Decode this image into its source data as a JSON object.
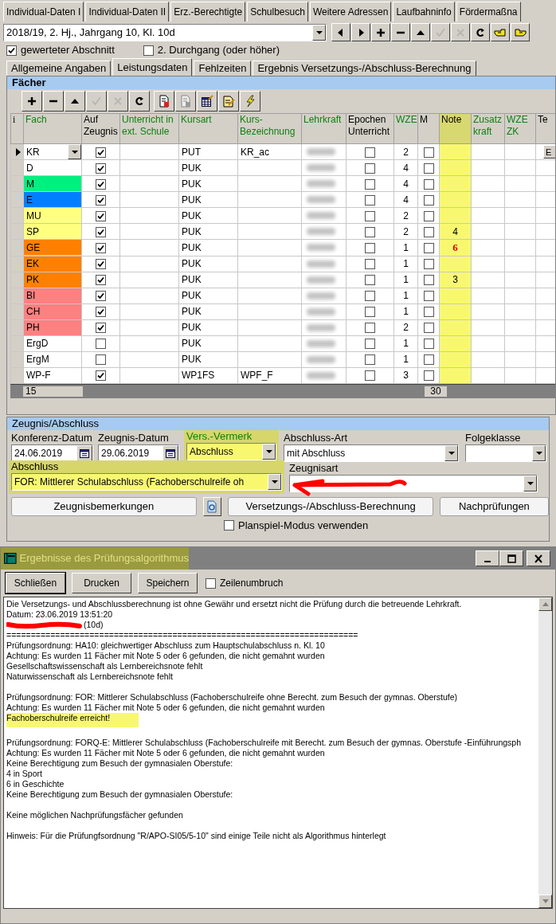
{
  "top_tabs": [
    {
      "label": "Individual-Daten I"
    },
    {
      "label": "Individual-Daten II"
    },
    {
      "label": "Erz.-Berechtigte"
    },
    {
      "label": "Schulbesuch"
    },
    {
      "label": "Weitere Adressen"
    },
    {
      "label": "Laufbahninfo"
    },
    {
      "label": "Fördermaßna"
    }
  ],
  "section_select": {
    "value": "2018/19, 2. Hj., Jahrgang 10, Kl. 10d"
  },
  "nav_buttons": [
    {
      "kind": "prev",
      "disabled": false
    },
    {
      "kind": "next",
      "disabled": false
    },
    {
      "kind": "plus",
      "disabled": false
    },
    {
      "kind": "minus",
      "disabled": false
    },
    {
      "kind": "up",
      "disabled": false
    },
    {
      "kind": "check",
      "disabled": true
    },
    {
      "kind": "cancel",
      "disabled": true
    },
    {
      "kind": "refresh",
      "disabled": false
    },
    {
      "kind": "hand",
      "disabled": false
    },
    {
      "kind": "hand2",
      "disabled": false
    }
  ],
  "options": [
    {
      "label": "gewerteter Abschnitt",
      "checked": true
    },
    {
      "label": "2. Durchgang (oder höher)",
      "checked": false
    }
  ],
  "tabs": [
    {
      "label": "Allgemeine Angaben",
      "selected": false
    },
    {
      "label": "Leistungsdaten",
      "selected": true
    },
    {
      "label": "Fehlzeiten",
      "selected": false
    },
    {
      "label": "Ergebnis Versetzungs-/Abschluss-Berechnung",
      "selected": false
    }
  ],
  "faecher": {
    "title": "Fächer",
    "toolbar": [
      {
        "kind": "plus",
        "disabled": false
      },
      {
        "kind": "minus",
        "disabled": false
      },
      {
        "kind": "up",
        "disabled": false
      },
      {
        "kind": "check",
        "disabled": true
      },
      {
        "kind": "cancel",
        "disabled": true
      },
      {
        "kind": "refresh",
        "disabled": false
      },
      {
        "kind": "doc-red",
        "disabled": false
      },
      {
        "kind": "doc-gray",
        "disabled": false
      },
      {
        "kind": "table-edit",
        "disabled": false
      },
      {
        "kind": "doc-pencil",
        "disabled": false
      },
      {
        "kind": "bolt",
        "disabled": false
      }
    ],
    "columns": [
      {
        "label": "i",
        "accent": false
      },
      {
        "label": "Fach",
        "accent": true
      },
      {
        "label": "Auf\nZeugnis",
        "accent": false
      },
      {
        "label": "Unterricht in\next. Schule",
        "accent": true
      },
      {
        "label": "Kursart",
        "accent": true
      },
      {
        "label": "Kurs-\nBezeichnung",
        "accent": true
      },
      {
        "label": "Lehrkraft",
        "accent": true
      },
      {
        "label": "Epochen\nUnterricht",
        "accent": false
      },
      {
        "label": "WZE",
        "accent": true
      },
      {
        "label": "M",
        "accent": false
      },
      {
        "label": "Note",
        "accent": false
      },
      {
        "label": "Zusatz\nkraft",
        "accent": true
      },
      {
        "label": "WZE\nZK",
        "accent": true
      },
      {
        "label": "Te",
        "accent": false
      }
    ],
    "rows": [
      {
        "fach": "KR",
        "color": "#ffffff",
        "selected": true,
        "auf_zeugnis": true,
        "kursart": "PUT",
        "kurs_bezeichnung": "KR_ac",
        "epochen": false,
        "wze": "2",
        "m": false,
        "extra": "E"
      },
      {
        "fach": "D",
        "color": "#ffffff",
        "selected": false,
        "auf_zeugnis": true,
        "kursart": "PUK",
        "epochen": false,
        "wze": "4",
        "m": false
      },
      {
        "fach": "M",
        "color": "#00f080",
        "selected": false,
        "auf_zeugnis": true,
        "kursart": "PUK",
        "epochen": false,
        "wze": "4",
        "m": false
      },
      {
        "fach": "E",
        "color": "#0080ff",
        "selected": false,
        "auf_zeugnis": true,
        "kursart": "PUK",
        "epochen": false,
        "wze": "4",
        "m": false
      },
      {
        "fach": "MU",
        "color": "#ffff80",
        "selected": false,
        "auf_zeugnis": true,
        "kursart": "PUK",
        "epochen": false,
        "wze": "2",
        "m": false
      },
      {
        "fach": "SP",
        "color": "#ffff80",
        "selected": false,
        "auf_zeugnis": true,
        "kursart": "PUK",
        "epochen": false,
        "wze": "2",
        "m": false,
        "note": "4",
        "note_alert": false
      },
      {
        "fach": "GE",
        "color": "#ff8000",
        "selected": false,
        "auf_zeugnis": true,
        "kursart": "PUK",
        "epochen": false,
        "wze": "1",
        "m": false,
        "note": "6",
        "note_alert": true
      },
      {
        "fach": "EK",
        "color": "#ff8000",
        "selected": false,
        "auf_zeugnis": true,
        "kursart": "PUK",
        "epochen": false,
        "wze": "1",
        "m": false
      },
      {
        "fach": "PK",
        "color": "#ff8000",
        "selected": false,
        "auf_zeugnis": true,
        "kursart": "PUK",
        "epochen": false,
        "wze": "1",
        "m": false,
        "note": "3",
        "note_alert": false
      },
      {
        "fach": "BI",
        "color": "#ff8080",
        "selected": false,
        "auf_zeugnis": true,
        "kursart": "PUK",
        "epochen": false,
        "wze": "1",
        "m": false
      },
      {
        "fach": "CH",
        "color": "#ff8080",
        "selected": false,
        "auf_zeugnis": true,
        "kursart": "PUK",
        "epochen": false,
        "wze": "1",
        "m": false
      },
      {
        "fach": "PH",
        "color": "#ff8080",
        "selected": false,
        "auf_zeugnis": true,
        "kursart": "PUK",
        "epochen": false,
        "wze": "2",
        "m": false
      },
      {
        "fach": "ErgD",
        "color": "#ffffff",
        "selected": false,
        "auf_zeugnis": false,
        "kursart": "PUK",
        "epochen": false,
        "wze": "1",
        "m": false
      },
      {
        "fach": "ErgM",
        "color": "#ffffff",
        "selected": false,
        "auf_zeugnis": false,
        "kursart": "PUK",
        "epochen": false,
        "wze": "1",
        "m": false
      },
      {
        "fach": "WP-F",
        "color": "#ffffff",
        "selected": false,
        "auf_zeugnis": true,
        "kursart": "WP1FS",
        "kurs_bezeichnung": "WPF_F",
        "epochen": false,
        "wze": "3",
        "m": false
      }
    ],
    "footer": {
      "fach_count": "15",
      "wze_sum": "30"
    }
  },
  "zeugnis": {
    "title": "Zeugnis/Abschluss",
    "konferenz_datum": {
      "label": "Konferenz-Datum",
      "value": "24.06.2019"
    },
    "zeugnis_datum": {
      "label": "Zeugnis-Datum",
      "value": "29.06.2019"
    },
    "vers_vermerk": {
      "label": "Vers.-Vermerk",
      "value": "Abschluss"
    },
    "abschluss_art": {
      "label": "Abschluss-Art",
      "value": "mit Abschluss"
    },
    "folgeklasse": {
      "label": "Folgeklasse"
    },
    "abschluss": {
      "label": "Abschluss",
      "value": "FOR: Mittlerer Schulabschluss (Fachoberschulreife oh"
    },
    "zeugnisart": {
      "label": "Zeugnisart"
    },
    "buttons": [
      "Zeugnisbemerkungen",
      "Versetzungs-/Abschluss-Berechnung",
      "Nachprüfungen"
    ],
    "planspiel": {
      "label": "Planspiel-Modus verwenden",
      "checked": false
    }
  },
  "dialog": {
    "title": "Ergebnisse des Prüfungsalgorithmus",
    "buttons": [
      "Schließen",
      "Drucken",
      "Speichern"
    ],
    "wrap": {
      "label": "Zeilenumbruch",
      "checked": false
    },
    "lines": [
      {
        "kind": "line",
        "text": "Die Versetzungs- und Abschlussberechnung ist ohne Gewähr und ersetzt nicht die Prüfung durch die betreuende Lehrkraft."
      },
      {
        "kind": "line",
        "text": "Datum: 23.06.2019 13:51:20"
      },
      {
        "kind": "redacted",
        "text": "(10d)"
      },
      {
        "kind": "line",
        "text": "========================================================================"
      },
      {
        "kind": "line",
        "text": "Prüfungsordnung: HA10: gleichwertiger Abschluss zum Hauptschulabschluss n. Kl. 10"
      },
      {
        "kind": "line",
        "text": "Achtung: Es wurden 11 Fächer mit Note 5 oder 6 gefunden, die nicht gemahnt wurden"
      },
      {
        "kind": "line",
        "text": "Gesellschaftswissenschaft als Lernbereichsnote fehlt"
      },
      {
        "kind": "line",
        "text": "Naturwissenschaft als Lernbereichsnote fehlt"
      },
      {
        "kind": "blank"
      },
      {
        "kind": "line",
        "text": "Prüfungsordnung: FOR: Mittlerer Schulabschluss (Fachoberschulreife ohne Berecht. zum Besuch der gymnas. Oberstufe)"
      },
      {
        "kind": "line",
        "text": "Achtung: Es wurden 11 Fächer mit Note 5 oder 6 gefunden, die nicht gemahnt wurden"
      },
      {
        "kind": "highlight",
        "text": "Fachoberschulreife erreicht!"
      },
      {
        "kind": "blank"
      },
      {
        "kind": "line",
        "text": "Prüfungsordnung: FORQ-E:  Mittlerer Schulabschluss (Fachoberschulreife mit Berecht. zum Besuch der gymnas. Oberstufe -Einführungsph"
      },
      {
        "kind": "line",
        "text": "Achtung: Es wurden 11 Fächer mit Note 5 oder 6 gefunden, die nicht gemahnt wurden"
      },
      {
        "kind": "line",
        "text": "Keine Berechtigung zum Besuch der gymnasialen Oberstufe:"
      },
      {
        "kind": "line",
        "text": "4 in Sport"
      },
      {
        "kind": "line",
        "text": "6 in Geschichte"
      },
      {
        "kind": "line",
        "text": "Keine Berechtigung zum Besuch der gymnasialen Oberstufe:"
      },
      {
        "kind": "blank"
      },
      {
        "kind": "line",
        "text": "Keine möglichen Nachprüfungsfächer gefunden"
      },
      {
        "kind": "blank"
      },
      {
        "kind": "line",
        "text": "Hinweis: Für die Prüfungfsordnung \"R/APO-SI05/5-10\" sind einige Teile nicht als Algorithmus hinterlegt"
      }
    ]
  }
}
